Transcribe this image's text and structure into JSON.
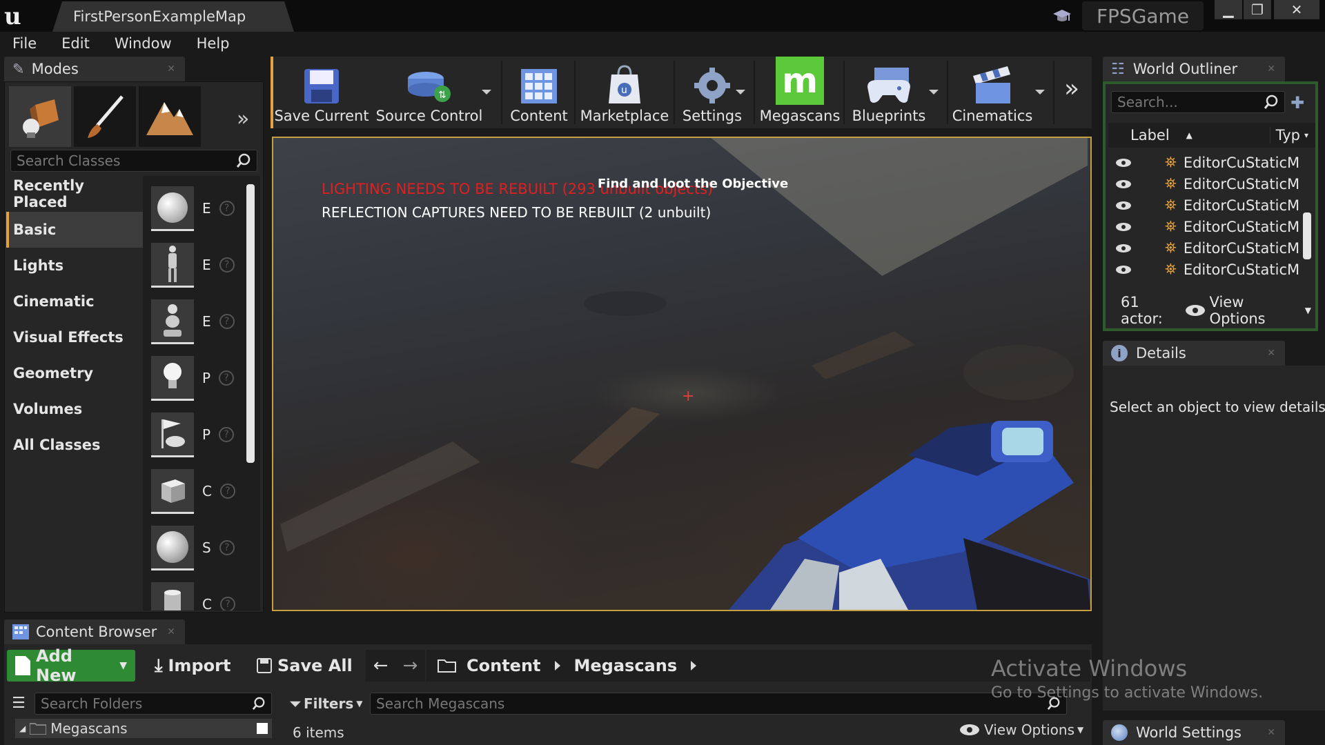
{
  "titlebar": {
    "map_tab": "FirstPersonExampleMap",
    "project_name": "FPSGame",
    "minimize": "▁",
    "restore": "❐",
    "close": "✕"
  },
  "menu": [
    "File",
    "Edit",
    "Window",
    "Help"
  ],
  "modes": {
    "tab_label": "Modes",
    "search_placeholder": "Search Classes",
    "categories": [
      "Recently Placed",
      "Basic",
      "Lights",
      "Cinematic",
      "Visual Effects",
      "Geometry",
      "Volumes",
      "All Classes"
    ],
    "active_category": "Basic",
    "place_items": [
      "E",
      "E",
      "E",
      "P",
      "P",
      "C",
      "S",
      "C"
    ]
  },
  "toolbar": {
    "save_current": "Save Current",
    "source_control": "Source Control",
    "content": "Content",
    "marketplace": "Marketplace",
    "settings": "Settings",
    "megascans": "Megascans",
    "blueprints": "Blueprints",
    "cinematics": "Cinematics"
  },
  "viewport": {
    "warning": "LIGHTING NEEDS TO BE REBUILT (293 unbuilt objects)",
    "objective": "Find and loot the Objective",
    "reflection": "REFLECTION CAPTURES NEED TO BE REBUILT (2 unbuilt)",
    "crosshair": "+"
  },
  "content_browser": {
    "tab_label": "Content Browser",
    "add_new": "Add New",
    "import": "Import",
    "save_all": "Save All",
    "path": [
      "Content",
      "Megascans"
    ],
    "search_folders_placeholder": "Search Folders",
    "folder": "Megascans",
    "filters": "Filters",
    "search_placeholder": "Search Megascans",
    "item_count": "6 items",
    "view_options": "View Options"
  },
  "world_outliner": {
    "tab_label": "World Outliner",
    "search_placeholder": "Search...",
    "col_label": "Label",
    "col_type": "Typ",
    "rows": [
      {
        "label": "EditorCu",
        "type": "StaticM"
      },
      {
        "label": "EditorCu",
        "type": "StaticM"
      },
      {
        "label": "EditorCu",
        "type": "StaticM"
      },
      {
        "label": "EditorCu",
        "type": "StaticM"
      },
      {
        "label": "EditorCu",
        "type": "StaticM"
      },
      {
        "label": "EditorCu",
        "type": "StaticM"
      }
    ],
    "actor_count": "61 actor:",
    "view_options": "View Options"
  },
  "details": {
    "tab_label": "Details",
    "message": "Select an object to view details."
  },
  "world_settings": {
    "tab_label": "World Settings"
  },
  "watermark": {
    "title": "Activate Windows",
    "subtitle": "Go to Settings to activate Windows."
  },
  "colors": {
    "accent": "#e3a23c",
    "add_new": "#2e8b34",
    "megascans": "#5cc93b",
    "warning": "#e02020"
  }
}
